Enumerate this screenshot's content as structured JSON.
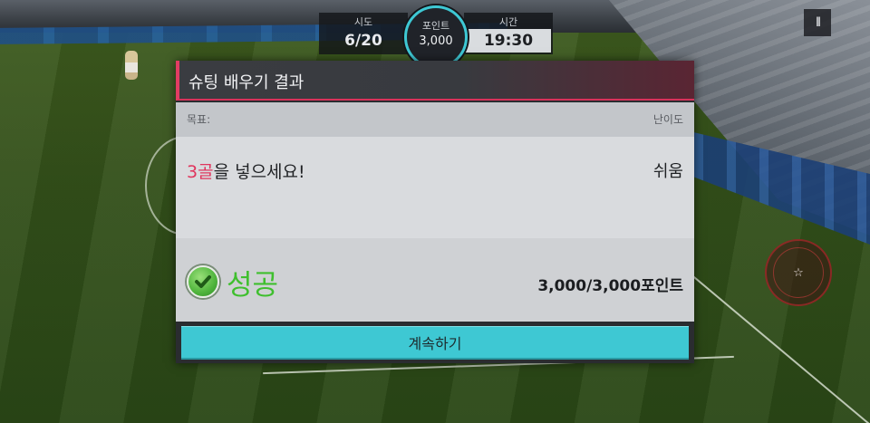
{
  "hud": {
    "attempts_label": "시도",
    "attempts_value": "6/20",
    "points_label": "포인트",
    "points_value": "3,000",
    "time_label": "시간",
    "time_value": "19:30"
  },
  "pause": {
    "icon": "pause-icon",
    "glyph": "II"
  },
  "dialog": {
    "title": "슈팅 배우기 결과",
    "goal_label": "목표:",
    "difficulty_label": "난이도",
    "goal_highlight": "3골",
    "goal_rest": "을 넣으세요!",
    "difficulty_value": "쉬움",
    "result": "성공",
    "score": "3,000/3,000포인트",
    "continue_label": "계속하기"
  },
  "colors": {
    "accent_pink": "#e0355d",
    "accent_cyan": "#3ec8d3",
    "success_green": "#3fbf2e"
  }
}
